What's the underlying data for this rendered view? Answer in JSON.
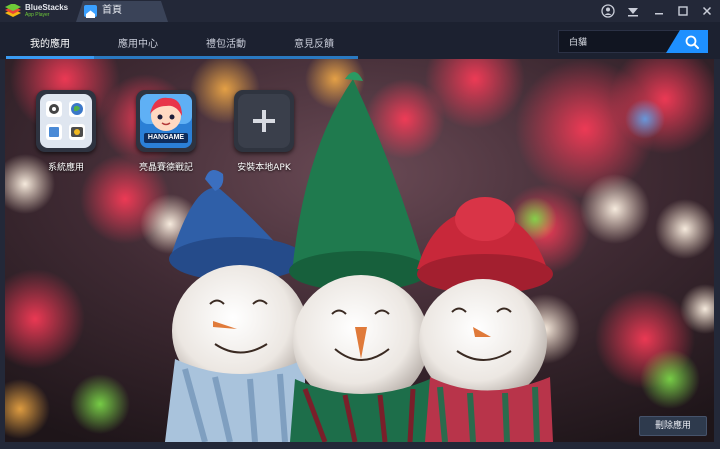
{
  "titlebar": {
    "brand": "BlueStacks",
    "brand_sub": "App Player",
    "home_tab": "首頁",
    "icons": [
      "account-icon",
      "wifi-icon",
      "minimize-icon",
      "maximize-icon",
      "close-icon"
    ]
  },
  "nav": {
    "tabs": [
      {
        "label": "我的應用",
        "active": true
      },
      {
        "label": "應用中心",
        "active": false
      },
      {
        "label": "禮包活動",
        "active": false
      },
      {
        "label": "意見反饋",
        "active": false
      }
    ]
  },
  "search": {
    "value": "白貓",
    "icon": "search-icon"
  },
  "apps": [
    {
      "label": "系統應用",
      "icon": "system-apps-icon"
    },
    {
      "label": "亮晶賽德戰記",
      "icon": "game-icon",
      "badge": "HANGAME"
    },
    {
      "label": "安裝本地APK",
      "icon": "plus-icon"
    }
  ],
  "actions": {
    "delete_label": "刪除應用"
  },
  "colors": {
    "titlebar": "#232838",
    "nav": "#1c2130",
    "accent": "#3a9bf2",
    "search_button": "#1e90ff"
  }
}
